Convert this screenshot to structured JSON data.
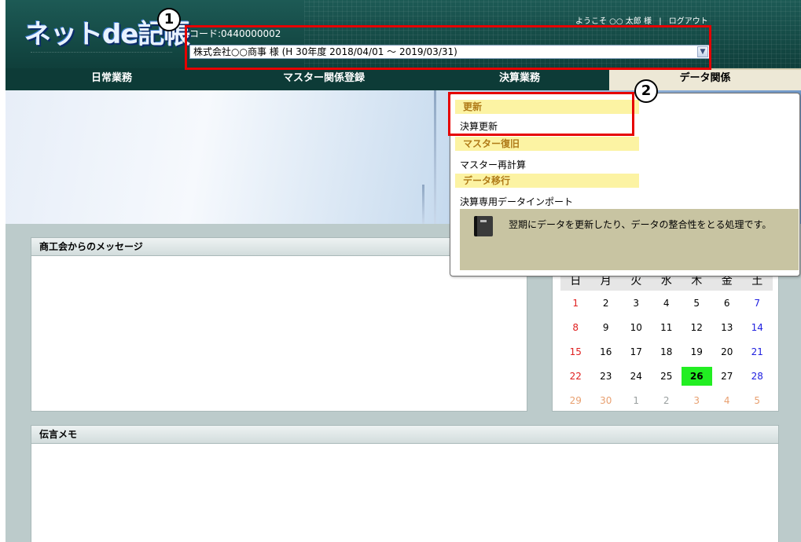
{
  "header": {
    "logo": "ネットde記帳",
    "welcome": "ようこそ ○○ 太郎 様",
    "separator": "|",
    "logout": "ログアウト",
    "code": "コード:0440000002",
    "company_selected": "株式会社○○商事 様 (H 30年度 2018/04/01 〜 2019/03/31)"
  },
  "nav": {
    "items": [
      {
        "label": "日常業務"
      },
      {
        "label": "マスター関係登録"
      },
      {
        "label": "決算業務"
      },
      {
        "label": "データ関係"
      }
    ]
  },
  "dropdown": {
    "sections": [
      {
        "title": "更新",
        "items": [
          "決算更新"
        ]
      },
      {
        "title": "マスター復旧",
        "items": [
          "マスター再計算"
        ]
      },
      {
        "title": "データ移行",
        "items": [
          "決算専用データインポート"
        ]
      }
    ],
    "tooltip": "翌期にデータを更新したり、データの整合性をとる処理です。"
  },
  "panels": {
    "messages_title": "商工会からのメッセージ",
    "memo_title": "伝言メモ"
  },
  "calendar": {
    "weekdays": [
      "日",
      "月",
      "火",
      "水",
      "木",
      "金",
      "土"
    ],
    "weeks": [
      [
        "1",
        "2",
        "3",
        "4",
        "5",
        "6",
        "7"
      ],
      [
        "8",
        "9",
        "10",
        "11",
        "12",
        "13",
        "14"
      ],
      [
        "15",
        "16",
        "17",
        "18",
        "19",
        "20",
        "21"
      ],
      [
        "22",
        "23",
        "24",
        "25",
        "26",
        "27",
        "28"
      ],
      [
        "29",
        "30",
        "1",
        "2",
        "3",
        "4",
        "5"
      ]
    ],
    "today": "26"
  },
  "annotations": {
    "badge1": "1",
    "badge2": "2",
    "highlight_color": "#e60000"
  },
  "colors": {
    "header_bg": "#0f3f3b",
    "nav_active_bg": "#ede8d6",
    "section_bg": "#fcf3a3",
    "section_text": "#b07b18",
    "today_bg": "#22ee22"
  }
}
